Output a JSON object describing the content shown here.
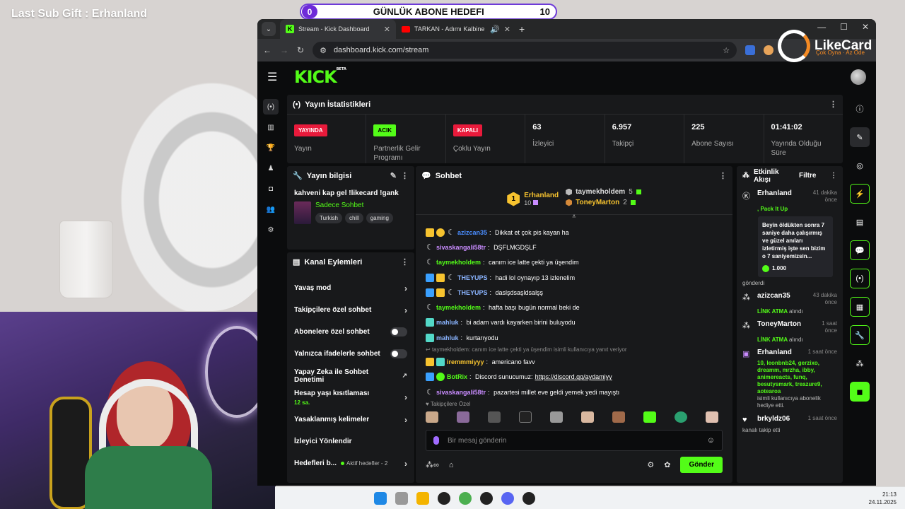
{
  "overlay": {
    "last_sub_gift": "Last Sub Gift : Erhanland",
    "goal": {
      "title": "GÜNLÜK ABONE HEDEFI",
      "current": "0",
      "target": "10"
    }
  },
  "browser": {
    "tabs": [
      {
        "title": "Stream - Kick Dashboard",
        "active": true
      },
      {
        "title": "TARKAN - Adımı Kalbine Yaz (",
        "active": false
      }
    ],
    "url": "dashboard.kick.com/stream"
  },
  "likecard": {
    "name": "LikeCard",
    "tagline": "Çok Oyna · Az Öde"
  },
  "kick": {
    "logo": "KICK",
    "logo_beta": "BETA",
    "stats": {
      "title": "Yayın İstatistikleri",
      "items": [
        {
          "badge": "YAYINDA",
          "badge_color": "#e91a3b",
          "label": "Yayın"
        },
        {
          "badge": "ACIK",
          "badge_color": "#53fc18",
          "label": "Partnerlik Gelir Programı"
        },
        {
          "badge": "KAPALI",
          "badge_color": "#e91a3b",
          "label": "Çoklu Yayın"
        },
        {
          "value": "63",
          "label": "İzleyici"
        },
        {
          "value": "6.957",
          "label": "Takipçi"
        },
        {
          "value": "225",
          "label": "Abone Sayısı"
        },
        {
          "value": "01:41:02",
          "label": "Yayında Olduğu Süre"
        }
      ]
    },
    "stream_info": {
      "title": "Yayın bilgisi",
      "stream_title": "kahveni kap gel !likecard !gank",
      "category": "Sadece Sohbet",
      "tags": [
        "Turkish",
        "chill",
        "gaming"
      ]
    },
    "channel_actions": {
      "title": "Kanal Eylemleri",
      "items": [
        {
          "label": "Yavaş mod",
          "type": "chevron"
        },
        {
          "label": "Takipçilere özel sohbet",
          "type": "chevron"
        },
        {
          "label": "Abonelere özel sohbet",
          "type": "toggle"
        },
        {
          "label": "Yalnızca ifadelerle sohbet",
          "type": "toggle"
        },
        {
          "label": "Yapay Zeka ile Sohbet Denetimi",
          "type": "external"
        },
        {
          "label": "Hesap yaşı kısıtlaması",
          "sub": "12 sa.",
          "type": "chevron"
        },
        {
          "label": "Yasaklanmış kelimeler",
          "type": "chevron"
        },
        {
          "label": "İzleyici Yönlendir",
          "type": "none"
        },
        {
          "label": "Hedefleri b...",
          "extra": "Aktif hedefler - 2",
          "type": "chevron"
        }
      ]
    },
    "chat": {
      "title": "Sohbet",
      "top_gifters": [
        {
          "rank": "1",
          "name": "Erhanland",
          "count": "10"
        },
        {
          "name": "taymekholdem",
          "count": "5"
        },
        {
          "name": "ToneyMarton",
          "count": "2"
        }
      ],
      "messages": [
        {
          "user": "azizcan35",
          "color": "#4a8dff",
          "text": "Dikkat et çok pis kayan ha",
          "badges": [
            "gold",
            "gold",
            "moon"
          ]
        },
        {
          "user": "sivaskangali58tr",
          "color": "#c98cff",
          "text": "DŞFLMGDŞLF",
          "badges": [
            "moon"
          ]
        },
        {
          "user": "taymekholdem",
          "color": "#53fc18",
          "text": "canım ice latte çekti ya üşendim",
          "badges": [
            "moon"
          ]
        },
        {
          "user": "THEYUPS",
          "color": "#8ab4ff",
          "text": "hadi lol oynayıp 13 izlenelim",
          "badges": [
            "blue",
            "gold",
            "moon"
          ]
        },
        {
          "user": "THEYUPS",
          "color": "#8ab4ff",
          "text": "daslşdsaşldsalşş",
          "badges": [
            "blue",
            "gold",
            "moon"
          ]
        },
        {
          "user": "taymekholdem",
          "color": "#53fc18",
          "text": "hafta başı bugün normal beki de",
          "badges": [
            "moon"
          ]
        },
        {
          "user": "mahluk",
          "color": "#8ab4ff",
          "text": "bi adam vardı kayarken birini buluyodu",
          "badges": [
            "teal"
          ]
        },
        {
          "user": "mahluk",
          "color": "#8ab4ff",
          "text": "kurtarıyodu",
          "badges": [
            "teal"
          ]
        }
      ],
      "reply_note": "taymekholdem: canım ice latte çekti ya üşendim isimli kullanıcıya yanıt veriyor",
      "messages2": [
        {
          "user": "iremmmiyyy",
          "color": "#f7c32f",
          "text": "americano favv",
          "badges": [
            "gold",
            "teal"
          ]
        },
        {
          "user": "BotRix",
          "color": "#53fc18",
          "text": "Discord sunucumuz: ",
          "link": "https://discord.gg/aydamiyy",
          "badges": [
            "blue",
            "green"
          ]
        },
        {
          "user": "sivaskangali58tr",
          "color": "#c98cff",
          "text": "pazartesi millet eve geldi yemek yedi mayıştı",
          "badges": [
            "moon"
          ]
        }
      ],
      "emote_label": "♥ Takipçilere Özel",
      "input_placeholder": "Bir mesaj gönderin",
      "send_label": "Gönder"
    },
    "activity": {
      "title": "Etkinlik Akışı",
      "filter": "Filtre",
      "items": [
        {
          "name": "Erhanland",
          "time": "41 dakika önce",
          "green": ", Pack It Up",
          "card": "Beyin öldükten sonra 7 saniye daha çalışırmış ve güzel anıları izletirmiş işte sen bizim o 7 saniyemizsin...",
          "kicks": "1.000",
          "note": "gönderdi"
        },
        {
          "name": "azizcan35",
          "time": "43 dakika önce",
          "green": "LİNK ATMA",
          "note": "alındı"
        },
        {
          "name": "ToneyMarton",
          "time": "1 saat önce",
          "green": "LİNK ATMA",
          "note": "alındı"
        },
        {
          "name": "Erhanland",
          "time": "1 saat önce",
          "gifts": "10, leonbnb24, gerzixo, dreamm, mrzha, ibby, animereacts, funq, besutysmark, treazure9, aotearoa",
          "note": "isimli kullanıcıya abonelik hediye etti."
        },
        {
          "name": "brkyldz06",
          "time": "1 saat önce",
          "note": "kanalı takip etti"
        }
      ]
    }
  },
  "taskbar": {
    "time": "21:13",
    "date": "24.11.2025"
  }
}
